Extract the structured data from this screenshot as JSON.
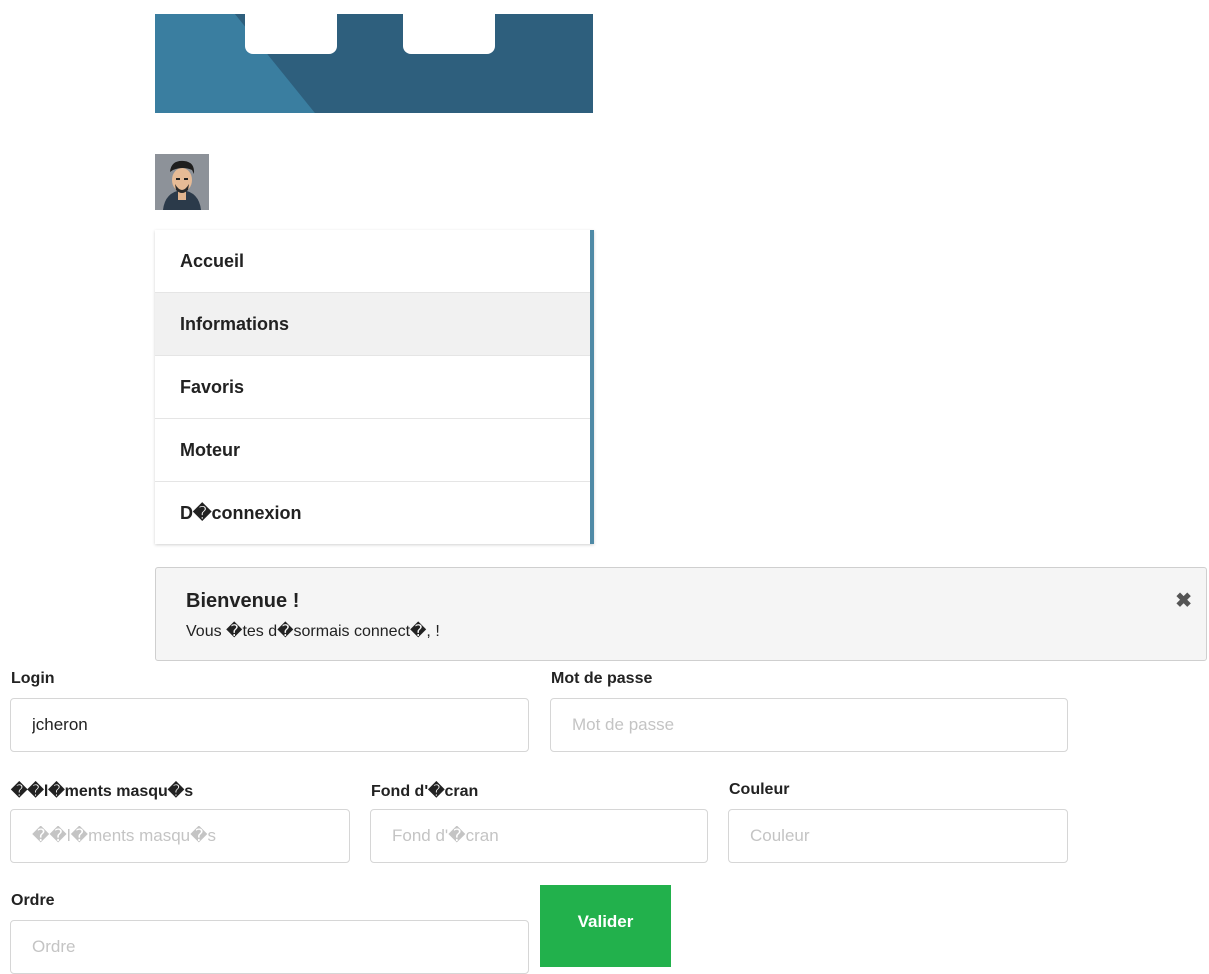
{
  "nav": {
    "items": [
      {
        "label": "Accueil"
      },
      {
        "label": "Informations"
      },
      {
        "label": "Favoris"
      },
      {
        "label": "Moteur"
      },
      {
        "label": "D�connexion"
      }
    ],
    "active_index": 1,
    "accent_color": "#4f8aa6"
  },
  "alert": {
    "title": "Bienvenue !",
    "message": "Vous �tes d�sormais connect�, !",
    "close_icon": "close-icon"
  },
  "form": {
    "login": {
      "label": "Login",
      "value": "jcheron"
    },
    "password": {
      "label": "Mot de passe",
      "placeholder": "Mot de passe"
    },
    "hidden_elements": {
      "label": "��l�ments masqu�s",
      "placeholder": "��l�ments masqu�s"
    },
    "wallpaper": {
      "label": "Fond d'�cran",
      "placeholder": "Fond d'�cran"
    },
    "color": {
      "label": "Couleur",
      "placeholder": "Couleur"
    },
    "order": {
      "label": "Ordre",
      "placeholder": "Ordre"
    },
    "submit_label": "Valider",
    "submit_color": "#22b14c"
  }
}
